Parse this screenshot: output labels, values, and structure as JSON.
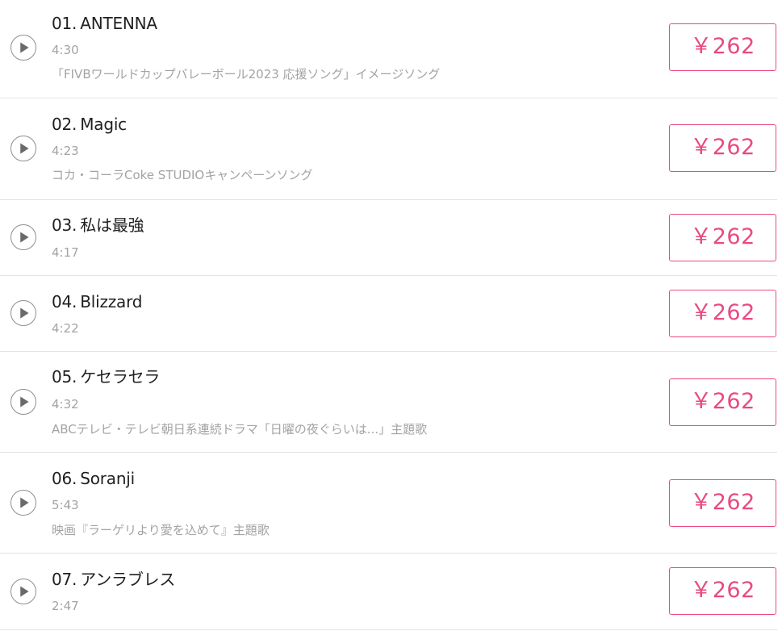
{
  "tracks": [
    {
      "number": "01.",
      "title": "ANTENNA",
      "duration": "4:30",
      "note": "「FIVBワールドカップバレーボール2023 応援ソング」イメージソング",
      "price": "￥262"
    },
    {
      "number": "02.",
      "title": "Magic",
      "duration": "4:23",
      "note": "コカ・コーラCoke STUDIOキャンペーンソング",
      "price": "￥262"
    },
    {
      "number": "03.",
      "title": "私は最強",
      "duration": "4:17",
      "note": "",
      "price": "￥262"
    },
    {
      "number": "04.",
      "title": "Blizzard",
      "duration": "4:22",
      "note": "",
      "price": "￥262"
    },
    {
      "number": "05.",
      "title": "ケセラセラ",
      "duration": "4:32",
      "note": "ABCテレビ・テレビ朝日系連続ドラマ「日曜の夜ぐらいは...」主題歌",
      "price": "￥262"
    },
    {
      "number": "06.",
      "title": "Soranji",
      "duration": "5:43",
      "note": "映画『ラーゲリより愛を込めて』主題歌",
      "price": "￥262"
    },
    {
      "number": "07.",
      "title": "アンラブレス",
      "duration": "2:47",
      "note": "",
      "price": "￥262"
    }
  ],
  "colors": {
    "price_accent": "#e84a82",
    "title_text": "#1f1f1f",
    "meta_text": "#a3a3a3",
    "divider": "#e2e2e2"
  },
  "icons": {
    "play": "play-icon"
  }
}
